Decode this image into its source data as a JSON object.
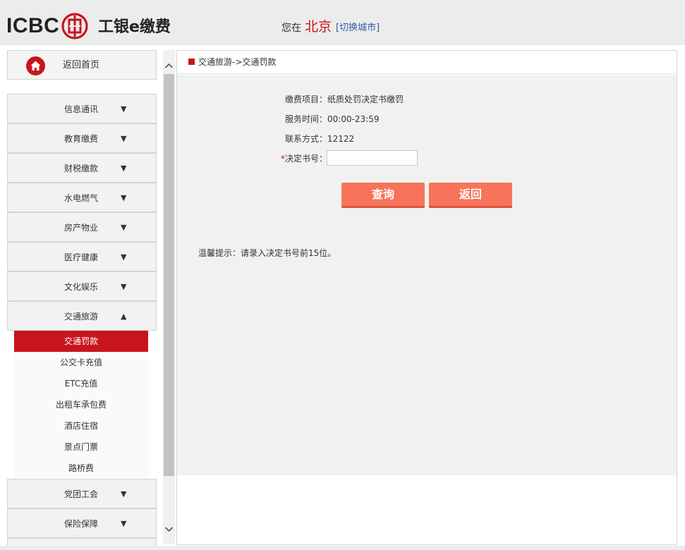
{
  "header": {
    "logo_text": "ICBC",
    "logo_emblem": "icbc-emblem",
    "app_title": "工银e缴费",
    "location_prefix": "您在",
    "city": "北京",
    "switch_city": "[切换城市]"
  },
  "sidebar": {
    "home_label": "返回首页",
    "home_icon": "home-icon",
    "categories": [
      {
        "label": "信息通讯",
        "arrow": "▼"
      },
      {
        "label": "教育缴费",
        "arrow": "▼"
      },
      {
        "label": "财税缴款",
        "arrow": "▼"
      },
      {
        "label": "水电燃气",
        "arrow": "▼"
      },
      {
        "label": "房产物业",
        "arrow": "▼"
      },
      {
        "label": "医疗健康",
        "arrow": "▼"
      },
      {
        "label": "文化娱乐",
        "arrow": "▼"
      },
      {
        "label": "交通旅游",
        "arrow": "▲"
      },
      {
        "label": "党团工会",
        "arrow": "▼"
      },
      {
        "label": "保险保障",
        "arrow": "▼"
      }
    ],
    "sub_items": [
      {
        "label": "交通罚款",
        "active": true
      },
      {
        "label": "公交卡充值"
      },
      {
        "label": "ETC充值"
      },
      {
        "label": "出租车承包费"
      },
      {
        "label": "酒店住宿"
      },
      {
        "label": "景点门票"
      },
      {
        "label": "路桥费"
      }
    ]
  },
  "main": {
    "breadcrumb": "交通旅游->交通罚款",
    "item_label": "缴费项目：",
    "item_value": "纸质处罚决定书缴罚",
    "time_label": "服务时间：",
    "time_value": "00:00-23:59",
    "contact_label": "联系方式：",
    "contact_value": "12122",
    "required_mark": "*",
    "decision_label": "决定书号：",
    "decision_value": "",
    "query_button": "查询",
    "back_button": "返回",
    "tip": "温馨提示：请录入决定书号前15位。"
  },
  "colors": {
    "brand_red": "#c8151d",
    "button": "#f7745a",
    "link": "#2a5ea8"
  }
}
